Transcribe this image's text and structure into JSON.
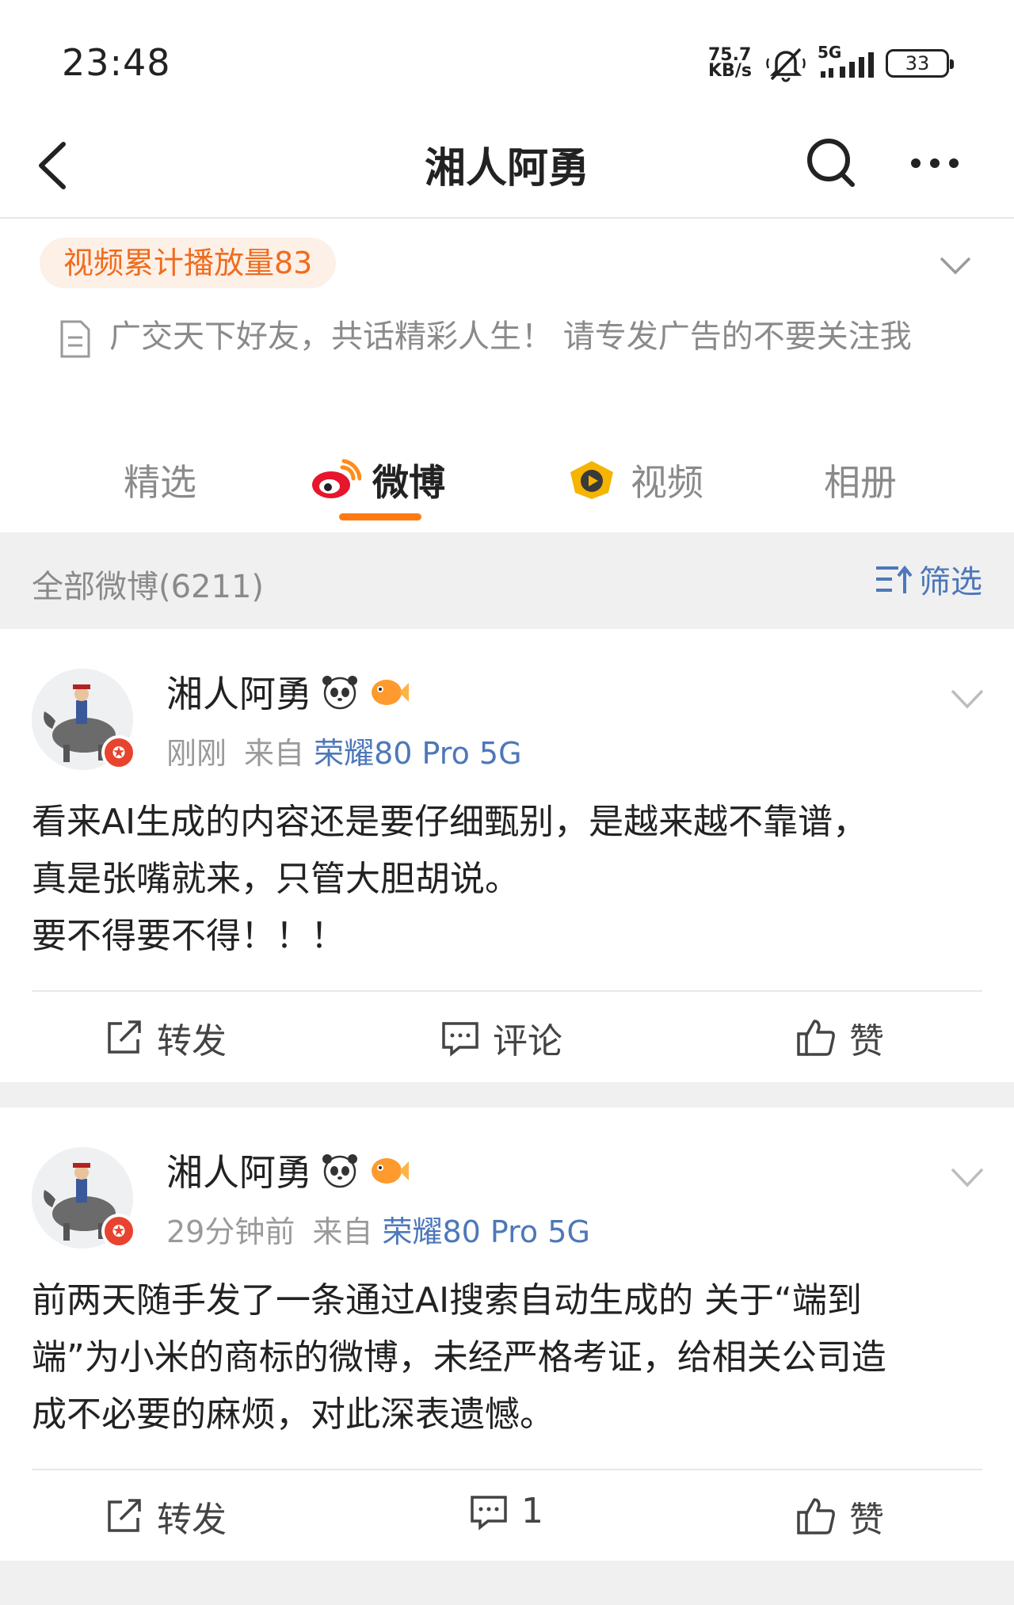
{
  "status_bar": {
    "time": "23:48",
    "net_speed_value": "75.7",
    "net_speed_unit": "KB/s",
    "network": "5G",
    "battery": "33"
  },
  "nav": {
    "title": "湘人阿勇",
    "icons": [
      "back-arrow-icon",
      "search-icon",
      "more-icon"
    ]
  },
  "profile": {
    "view_badge": "视频累计播放量83",
    "bio": "广交天下好友，共话精彩人生！ 请专发广告的不要关注我"
  },
  "tabs": [
    {
      "label": "精选",
      "active": false
    },
    {
      "label": "微博",
      "active": true
    },
    {
      "label": "视频",
      "active": false
    },
    {
      "label": "相册",
      "active": false
    }
  ],
  "filter": {
    "count_label": "全部微博(6211)",
    "filter_label": "筛选"
  },
  "posts": [
    {
      "author": "湘人阿勇",
      "time": "刚刚",
      "from_label": "来自",
      "source": "荣耀80 Pro 5G",
      "lines": [
        "看来AI生成的内容还是要仔细甄别，是越来越不靠谱，",
        "真是张嘴就来，只管大胆胡说。",
        "要不得要不得！！！"
      ],
      "actions": {
        "repost": "转发",
        "comment": "评论",
        "like": "赞"
      }
    },
    {
      "author": "湘人阿勇",
      "time": "29分钟前",
      "from_label": "来自",
      "source": "荣耀80 Pro 5G",
      "lines": [
        "前两天随手发了一条通过AI搜索自动生成的 关于“端到",
        "端”为小米的商标的微博，未经严格考证，给相关公司造",
        "成不必要的麻烦，对此深表遗憾。"
      ],
      "actions": {
        "repost": "转发",
        "comment": "1",
        "like": "赞"
      }
    }
  ],
  "colors": {
    "accent_orange": "#ff7a12",
    "link_blue": "#4d78b9",
    "badge_text": "#ef6c1f",
    "badge_bg": "#fdf0e7"
  }
}
